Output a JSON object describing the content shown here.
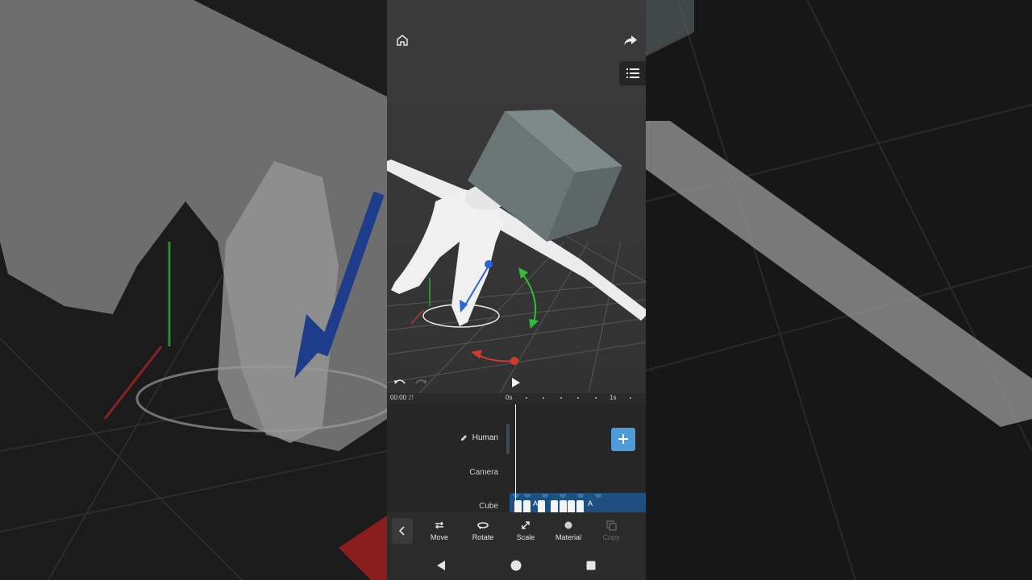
{
  "top_bar": {
    "home_icon": "home-icon",
    "share_icon": "share-arrow-icon",
    "list_icon": "list-icon"
  },
  "viewport": {
    "objects": [
      "Human",
      "Cube"
    ],
    "gizmo": {
      "x_color": "#d33a2f",
      "y_color": "#2fbe38",
      "z_color": "#2a64d6"
    }
  },
  "playback": {
    "undo_icon": "undo-icon",
    "redo_icon": "redo-icon",
    "play_icon": "play-icon"
  },
  "timeline": {
    "time": "00:00",
    "frame": "2f",
    "ticks": [
      "0s",
      "1s"
    ]
  },
  "tracks": [
    {
      "label": "Human",
      "selected": true,
      "icon": "pencil-icon"
    },
    {
      "label": "Camera",
      "selected": false
    },
    {
      "label": "Cube",
      "selected": false
    }
  ],
  "cube_clip": {
    "labels": [
      "A",
      "A"
    ]
  },
  "toolbar": {
    "back_icon": "chevron-left-icon",
    "tools": [
      {
        "label": "Move",
        "icon": "move-icon",
        "enabled": true
      },
      {
        "label": "Rotate",
        "icon": "rotate-icon",
        "enabled": true
      },
      {
        "label": "Scale",
        "icon": "scale-icon",
        "enabled": true
      },
      {
        "label": "Material",
        "icon": "material-icon",
        "enabled": true
      },
      {
        "label": "Copy",
        "icon": "copy-icon",
        "enabled": false
      }
    ]
  },
  "system_nav": [
    "back-icon",
    "home-circle-icon",
    "recents-icon"
  ],
  "colors": {
    "accent": "#4d9bd8",
    "clip": "#1d4f7f"
  }
}
